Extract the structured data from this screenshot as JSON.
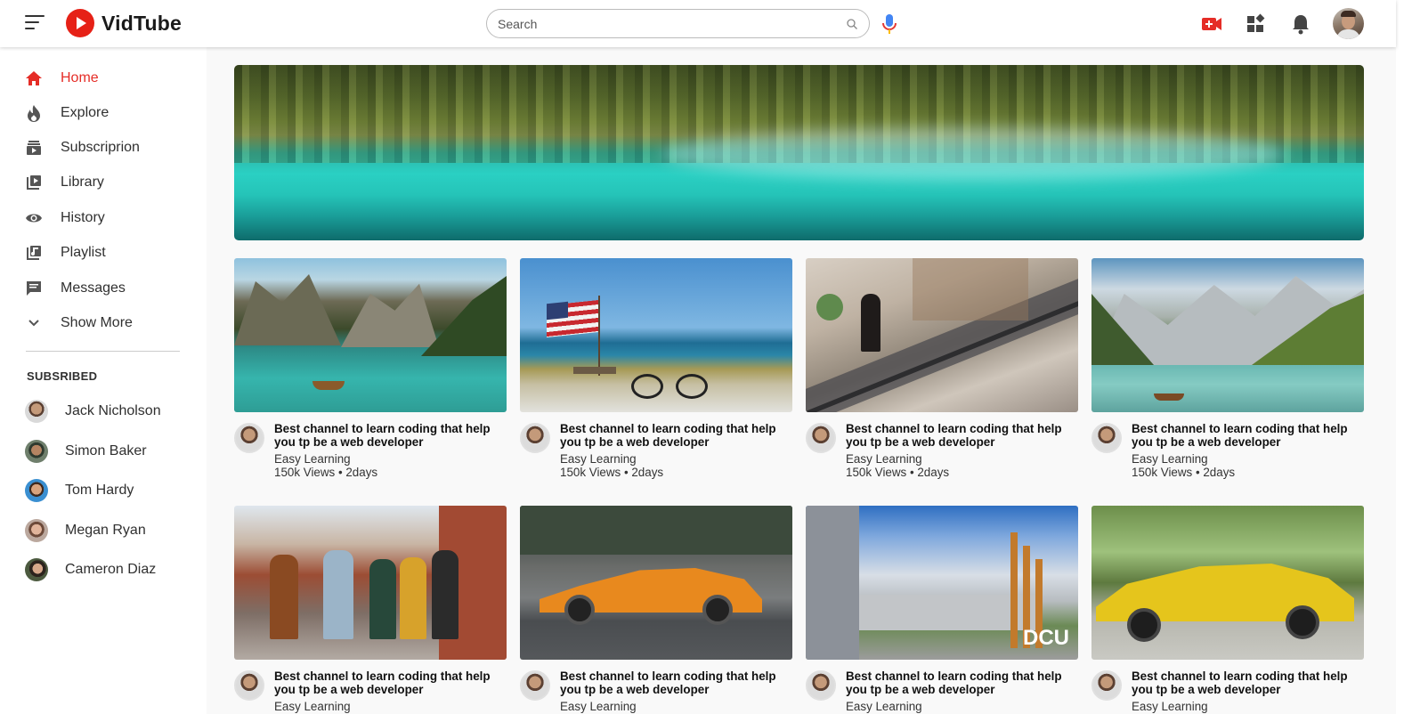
{
  "app": {
    "name": "VidTube"
  },
  "search": {
    "placeholder": "Search"
  },
  "header_icons": [
    "video-add-icon",
    "apps-icon",
    "notification-bell-icon"
  ],
  "colors": {
    "accent": "#e52d27",
    "logo_red": "#e62117",
    "mic_blue": "#4285f4"
  },
  "sidebar": {
    "items": [
      {
        "label": "Home",
        "icon": "home-icon",
        "active": true
      },
      {
        "label": "Explore",
        "icon": "explore-icon"
      },
      {
        "label": "Subscriprion",
        "icon": "subscription-icon"
      },
      {
        "label": "Library",
        "icon": "library-icon"
      },
      {
        "label": "History",
        "icon": "history-icon"
      },
      {
        "label": "Playlist",
        "icon": "playlist-icon"
      },
      {
        "label": "Messages",
        "icon": "messages-icon"
      },
      {
        "label": "Show More",
        "icon": "chevron-down-icon"
      }
    ],
    "subscribed_title": "SUBSRIBED",
    "subscriptions": [
      {
        "name": "Jack Nicholson"
      },
      {
        "name": "Simon Baker"
      },
      {
        "name": "Tom Hardy"
      },
      {
        "name": "Megan Ryan"
      },
      {
        "name": "Cameron Diaz"
      }
    ]
  },
  "videos": [
    {
      "title": "Best channel to learn coding that help you tp be a web developer",
      "channel": "Easy Learning",
      "stats": "150k Views • 2days",
      "thumbnail": "mountain-lake-boat"
    },
    {
      "title": "Best channel to learn coding that help you tp be a web developer",
      "channel": "Easy Learning",
      "stats": "150k Views • 2days",
      "thumbnail": "beach-flag-bicycle"
    },
    {
      "title": "Best channel to learn coding that help you tp be a web developer",
      "channel": "Easy Learning",
      "stats": "150k Views • 2days",
      "thumbnail": "mall-escalator"
    },
    {
      "title": "Best channel to learn coding that help you tp be a web developer",
      "channel": "Easy Learning",
      "stats": "150k Views • 2days",
      "thumbnail": "alpine-lake-boat"
    },
    {
      "title": "Best channel to learn coding that help you tp be a web developer",
      "channel": "Easy Learning",
      "stats": "",
      "thumbnail": "friends-walking"
    },
    {
      "title": "Best channel to learn coding that help you tp be a web developer",
      "channel": "Easy Learning",
      "stats": "",
      "thumbnail": "orange-sports-car"
    },
    {
      "title": "Best channel to learn coding that help you tp be a web developer",
      "channel": "Easy Learning",
      "stats": "",
      "thumbnail": "dcu-campus"
    },
    {
      "title": "Best channel to learn coding that help you tp be a web developer",
      "channel": "Easy Learning",
      "stats": "",
      "thumbnail": "yellow-sports-car"
    }
  ]
}
